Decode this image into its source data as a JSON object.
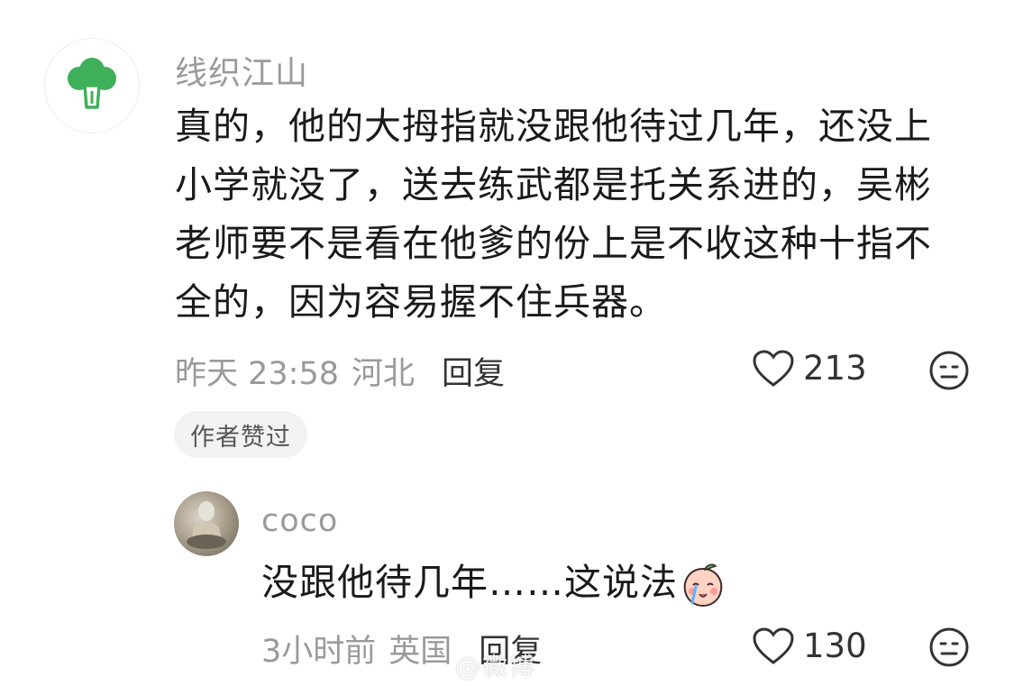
{
  "comments": [
    {
      "username": "线织江山",
      "text": "真的，他的大拇指就没跟他待过几年，还没上小学就没了，送去练武都是托关系进的，吴彬老师要不是看在他爹的份上是不收这种十指不全的，因为容易握不住兵器。",
      "time": "昨天 23:58",
      "location": "河北",
      "reply_label": "回复",
      "likes": "213",
      "author_badge": "作者赞过",
      "avatar_icon": "broccoli-icon"
    },
    {
      "username": "coco",
      "text": "没跟他待几年……这说法",
      "emoji": "crying-peach-emoji",
      "time": "3小时前",
      "location": "英国",
      "reply_label": "回复",
      "likes": "130"
    }
  ],
  "watermark": "@微博",
  "colors": {
    "meta_gray": "#9a9a9a",
    "text_dark": "#1a1a1a",
    "broccoli_green": "#3fb05a",
    "badge_bg": "#f2f2f2"
  }
}
